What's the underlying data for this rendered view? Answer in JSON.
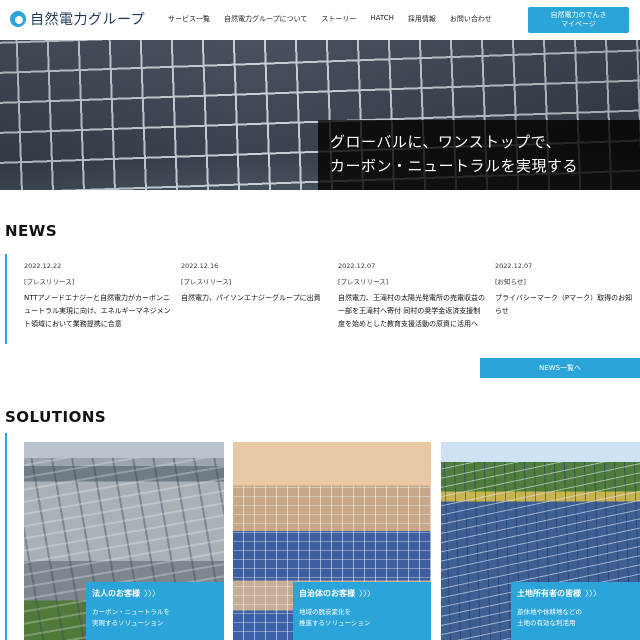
{
  "header": {
    "logo_text": "自然電力グループ",
    "nav": [
      "サービス一覧",
      "自然電力グループについて",
      "ストーリー",
      "HATCH",
      "採用情報",
      "お問い合わせ"
    ],
    "cta_line1": "自然電力のでんき",
    "cta_line2": "マイページ"
  },
  "hero": {
    "line1": "グローバルに、ワンストップで、",
    "line2": "カーボン・ニュートラルを実現する"
  },
  "news": {
    "title": "NEWS",
    "items": [
      {
        "date": "2022.12.22",
        "category": "[プレスリリース]",
        "text": "NTTアノードエナジーと自然電力がカーボンニュートラル実現に向け、エネルギーマネジメント領域において業務提携に合意"
      },
      {
        "date": "2022.12.16",
        "category": "[プレスリリース]",
        "text": "自然電力、パイソンエナジーグループに出資"
      },
      {
        "date": "2022.12.07",
        "category": "[プレスリリース]",
        "text": "自然電力、王滝村の太陽光発電所の売電収益の一部を王滝村へ寄付 同村の奨学金返済支援制度を始めとした教育支援活動の原資に活用へ"
      },
      {
        "date": "2022.12.07",
        "category": "[お知らせ]",
        "text": "プライバシーマーク（Pマーク）取得のお知らせ"
      }
    ],
    "more_label": "NEWS一覧へ"
  },
  "solutions": {
    "title": "SOLUTIONS",
    "cards": [
      {
        "title": "法人のお客様",
        "arrow": "〉〉〉",
        "desc1": "カーボン・ニュートラルを",
        "desc2": "実現するソリューション"
      },
      {
        "title": "自治体のお客様",
        "arrow": "〉〉〉",
        "desc1": "地域の脱炭素化を",
        "desc2": "推進するソリューション"
      },
      {
        "title": "土地所有者の皆様",
        "arrow": "〉〉〉",
        "desc1": "遊休地や休耕地などの",
        "desc2": "土地の有効な利活用"
      }
    ]
  },
  "colors": {
    "accent": "#2ba4d9",
    "hero_box": "#000000"
  }
}
